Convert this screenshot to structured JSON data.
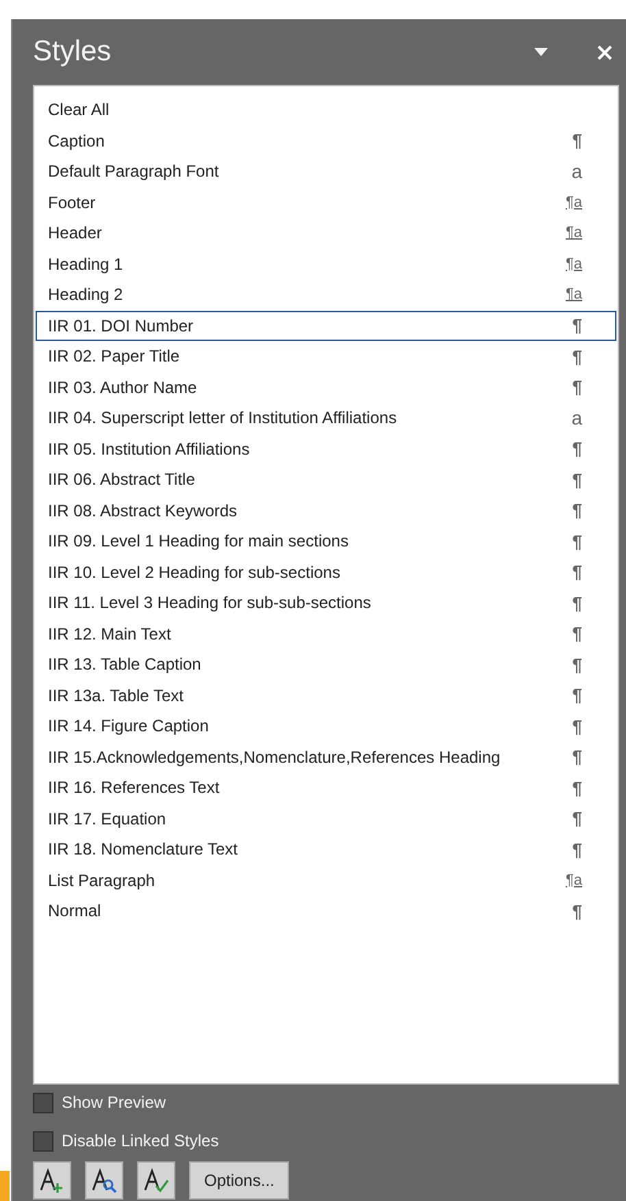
{
  "pane": {
    "title": "Styles"
  },
  "styles": [
    {
      "name": "Clear All",
      "kind": "none",
      "selected": false
    },
    {
      "name": "Caption",
      "kind": "paragraph",
      "symbol": "¶",
      "selected": false
    },
    {
      "name": "Default Paragraph Font",
      "kind": "character",
      "symbol": "a",
      "selected": false
    },
    {
      "name": "Footer",
      "kind": "linked",
      "symbol": "¶a",
      "selected": false
    },
    {
      "name": "Header",
      "kind": "linked",
      "symbol": "¶a",
      "selected": false
    },
    {
      "name": "Heading 1",
      "kind": "linked",
      "symbol": "¶a",
      "selected": false
    },
    {
      "name": "Heading 2",
      "kind": "linked",
      "symbol": "¶a",
      "selected": false
    },
    {
      "name": "IIR 01. DOI Number",
      "kind": "paragraph",
      "symbol": "¶",
      "selected": true
    },
    {
      "name": "IIR 02. Paper Title",
      "kind": "paragraph",
      "symbol": "¶",
      "selected": false
    },
    {
      "name": "IIR 03. Author Name",
      "kind": "paragraph",
      "symbol": "¶",
      "selected": false
    },
    {
      "name": "IIR 04. Superscript letter of Institution Affiliations",
      "kind": "character",
      "symbol": "a",
      "selected": false
    },
    {
      "name": "IIR 05. Institution Affiliations",
      "kind": "paragraph",
      "symbol": "¶",
      "selected": false
    },
    {
      "name": "IIR 06. Abstract Title",
      "kind": "paragraph",
      "symbol": "¶",
      "selected": false
    },
    {
      "name": "IIR 08. Abstract Keywords",
      "kind": "paragraph",
      "symbol": "¶",
      "selected": false
    },
    {
      "name": "IIR 09. Level 1 Heading for main sections",
      "kind": "paragraph",
      "symbol": "¶",
      "selected": false
    },
    {
      "name": "IIR 10. Level 2 Heading for sub-sections",
      "kind": "paragraph",
      "symbol": "¶",
      "selected": false
    },
    {
      "name": "IIR 11. Level 3 Heading for sub-sub-sections",
      "kind": "paragraph",
      "symbol": "¶",
      "selected": false
    },
    {
      "name": "IIR 12. Main Text",
      "kind": "paragraph",
      "symbol": "¶",
      "selected": false
    },
    {
      "name": "IIR 13. Table Caption",
      "kind": "paragraph",
      "symbol": "¶",
      "selected": false
    },
    {
      "name": "IIR 13a. Table Text",
      "kind": "paragraph",
      "symbol": "¶",
      "selected": false
    },
    {
      "name": "IIR 14. Figure Caption",
      "kind": "paragraph",
      "symbol": "¶",
      "selected": false
    },
    {
      "name": "IIR 15.Acknowledgements,Nomenclature,References Heading",
      "kind": "paragraph",
      "symbol": "¶",
      "selected": false
    },
    {
      "name": "IIR 16. References Text",
      "kind": "paragraph",
      "symbol": "¶",
      "selected": false
    },
    {
      "name": "IIR 17. Equation",
      "kind": "paragraph",
      "symbol": "¶",
      "selected": false
    },
    {
      "name": "IIR 18. Nomenclature Text",
      "kind": "paragraph",
      "symbol": "¶",
      "selected": false
    },
    {
      "name": "List Paragraph",
      "kind": "linked",
      "symbol": "¶a",
      "selected": false
    },
    {
      "name": "Normal",
      "kind": "paragraph",
      "symbol": "¶",
      "selected": false
    }
  ],
  "options": [
    {
      "label": "Show Preview",
      "checked": false
    },
    {
      "label": "Disable Linked Styles",
      "checked": false
    }
  ],
  "buttons": {
    "options": "Options..."
  }
}
